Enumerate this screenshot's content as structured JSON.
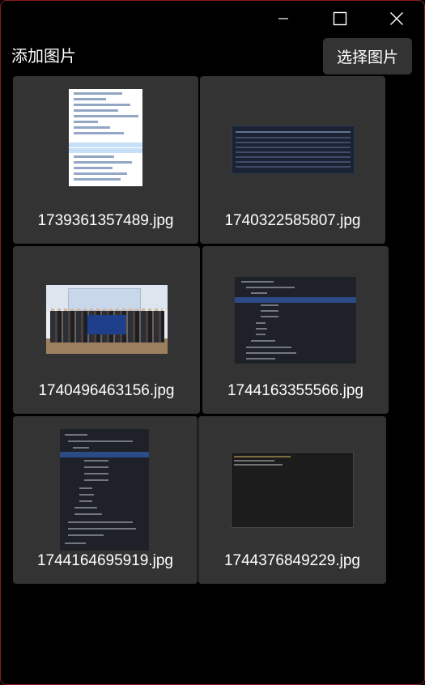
{
  "window": {
    "controls": {
      "minimize": "minimize-icon",
      "maximize": "maximize-icon",
      "close": "close-icon"
    }
  },
  "header": {
    "title": "添加图片",
    "select_button": "选择图片"
  },
  "images": [
    {
      "filename": "1739361357489.jpg",
      "thumbnail": "code-editor-screenshot"
    },
    {
      "filename": "1740322585807.jpg",
      "thumbnail": "dark-table-screenshot"
    },
    {
      "filename": "1740496463156.jpg",
      "thumbnail": "group-photo"
    },
    {
      "filename": "1744163355566.jpg",
      "thumbnail": "file-tree-screenshot"
    },
    {
      "filename": "1744164695919.jpg",
      "thumbnail": "file-tree-screenshot"
    },
    {
      "filename": "1744376849229.jpg",
      "thumbnail": "terminal-screenshot"
    }
  ]
}
